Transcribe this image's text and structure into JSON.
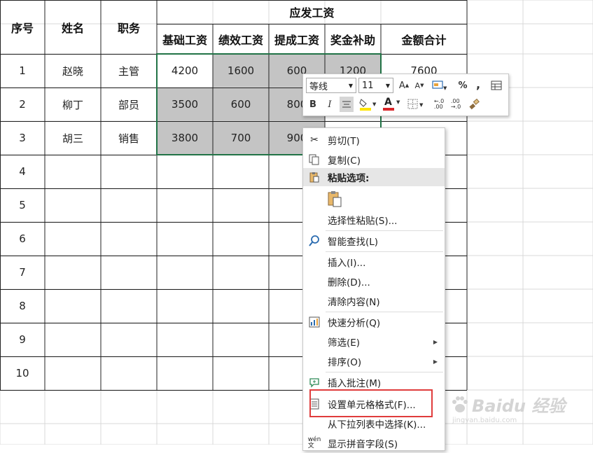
{
  "sheet": {
    "header": {
      "col_seq": "序号",
      "col_name": "姓名",
      "col_job": "职务",
      "group_title": "应发工资",
      "sub_base": "基础工资",
      "sub_perf": "绩效工资",
      "sub_comm": "提成工资",
      "sub_bonus": "奖金补助",
      "col_total": "金额合计"
    },
    "rows": [
      {
        "seq": "1",
        "name": "赵晓",
        "job": "主管",
        "base": "4200",
        "perf": "1600",
        "comm": "600",
        "bonus": "1200",
        "total": "7600"
      },
      {
        "seq": "2",
        "name": "柳丁",
        "job": "部员",
        "base": "3500",
        "perf": "600",
        "comm": "800",
        "bonus": "",
        "total": ""
      },
      {
        "seq": "3",
        "name": "胡三",
        "job": "销售",
        "base": "3800",
        "perf": "700",
        "comm": "900",
        "bonus": "",
        "total": ""
      },
      {
        "seq": "4"
      },
      {
        "seq": "5"
      },
      {
        "seq": "6"
      },
      {
        "seq": "7"
      },
      {
        "seq": "8"
      },
      {
        "seq": "9"
      },
      {
        "seq": "10"
      }
    ],
    "selection_fill": "#c4c4c4",
    "selection_border": "#217346"
  },
  "mini_toolbar": {
    "font_name": "等线",
    "font_size": "11",
    "percent": "%",
    "comma": ",",
    "bold": "B",
    "italic": "I",
    "font_color_letter": "A",
    "font_color": "#d9262a",
    "fill_color": "#ffe600"
  },
  "context_menu": {
    "cut": "剪切(T)",
    "copy": "复制(C)",
    "paste_options": "粘贴选项:",
    "paste_special": "选择性粘贴(S)...",
    "smart_lookup": "智能查找(L)",
    "insert": "插入(I)...",
    "delete": "删除(D)...",
    "clear": "清除内容(N)",
    "quick_analysis": "快速分析(Q)",
    "filter": "筛选(E)",
    "sort": "排序(O)",
    "insert_comment": "插入批注(M)",
    "format_cells": "设置单元格格式(F)...",
    "pick_list": "从下拉列表中选择(K)...",
    "phonetic": "显示拼音字段(S)"
  },
  "watermark": {
    "brand": "Baidu 经验",
    "url": "jingyan.baidu.com"
  },
  "highlight_color": "#e03c3c"
}
